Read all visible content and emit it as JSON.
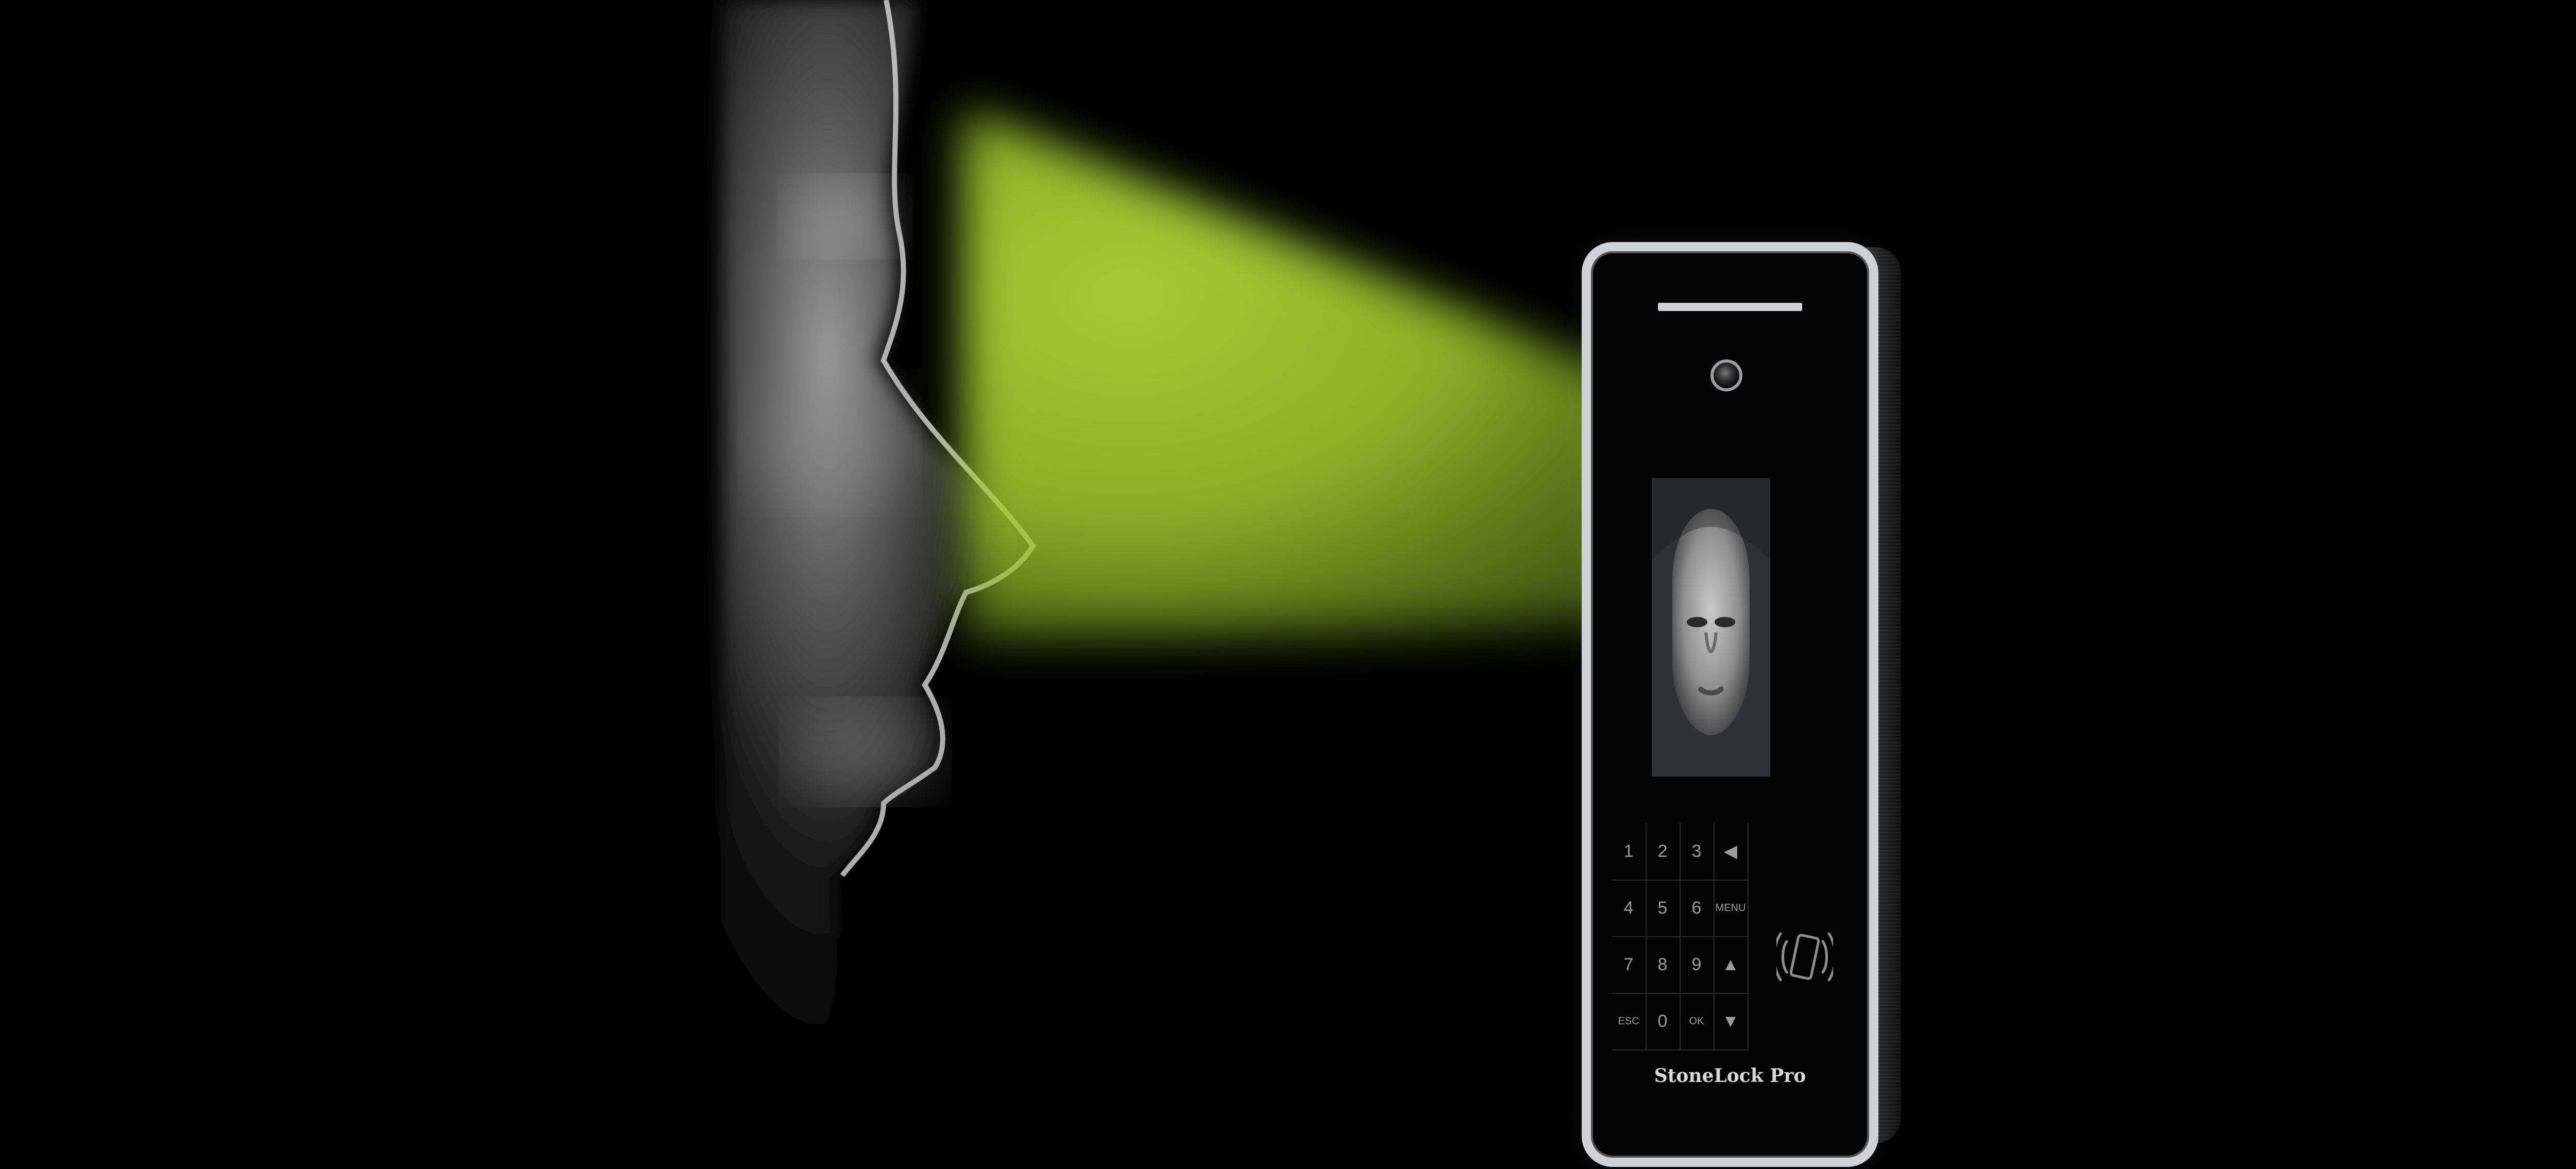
{
  "brand": {
    "name": "StoneLock Pro"
  },
  "keypad": {
    "rows": [
      [
        "1",
        "2",
        "3",
        "◀"
      ],
      [
        "4",
        "5",
        "6",
        "MENU"
      ],
      [
        "7",
        "8",
        "9",
        "▲"
      ],
      [
        "ESC",
        "0",
        "OK",
        "▼"
      ]
    ]
  },
  "colors": {
    "beam": "#a8cc2e",
    "device_border": "#cfd2d4",
    "background": "#000000"
  }
}
